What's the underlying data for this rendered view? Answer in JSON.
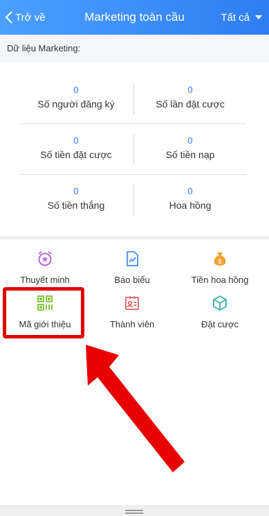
{
  "header": {
    "back_label": "Trở về",
    "title": "Marketing toàn cầu",
    "filter_label": "Tất cả"
  },
  "section": {
    "label": "Dữ liệu Marketing:"
  },
  "stats": [
    {
      "value": "0",
      "label": "Số người đăng ký"
    },
    {
      "value": "0",
      "label": "Số lần đặt cược"
    },
    {
      "value": "0",
      "label": "Số tiền đặt cược"
    },
    {
      "value": "0",
      "label": "Số tiền nạp"
    },
    {
      "value": "0",
      "label": "Số tiền thắng"
    },
    {
      "value": "0",
      "label": "Hoa hồng"
    }
  ],
  "menu": [
    {
      "label": "Thuyết minh",
      "icon": "alarm-star-icon"
    },
    {
      "label": "Báo biểu",
      "icon": "report-chart-icon"
    },
    {
      "label": "Tiền hoa hồng",
      "icon": "money-bag-icon"
    },
    {
      "label": "Mã giới thiệu",
      "icon": "qr-code-icon"
    },
    {
      "label": "Thành viên",
      "icon": "member-card-icon"
    },
    {
      "label": "Đặt cược",
      "icon": "cube-icon"
    }
  ],
  "colors": {
    "header_start": "#4aa0ff",
    "header_end": "#2f7df2",
    "stat_value": "#2f7df2",
    "highlight": "#e00000"
  }
}
